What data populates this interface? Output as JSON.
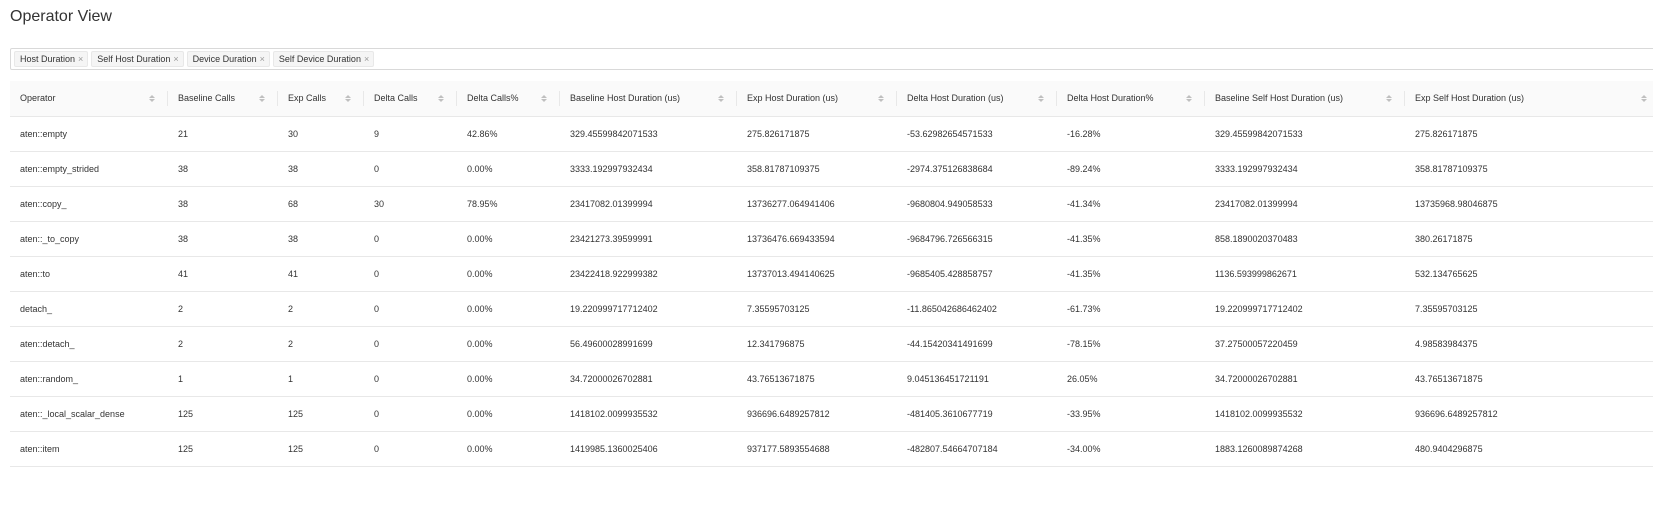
{
  "page": {
    "title": "Operator View"
  },
  "filters": {
    "tags": [
      {
        "label": "Host Duration",
        "close": "×"
      },
      {
        "label": "Self Host Duration",
        "close": "×"
      },
      {
        "label": "Device Duration",
        "close": "×"
      },
      {
        "label": "Self Device Duration",
        "close": "×"
      }
    ]
  },
  "table": {
    "columns": [
      "Operator",
      "Baseline Calls",
      "Exp Calls",
      "Delta Calls",
      "Delta Calls%",
      "Baseline Host Duration (us)",
      "Exp Host Duration (us)",
      "Delta Host Duration (us)",
      "Delta Host Duration%",
      "Baseline Self Host Duration (us)",
      "Exp Self Host Duration (us)"
    ],
    "rows": [
      [
        "aten::empty",
        "21",
        "30",
        "9",
        "42.86%",
        "329.45599842071533",
        "275.826171875",
        "-53.62982654571533",
        "-16.28%",
        "329.45599842071533",
        "275.826171875"
      ],
      [
        "aten::empty_strided",
        "38",
        "38",
        "0",
        "0.00%",
        "3333.192997932434",
        "358.81787109375",
        "-2974.375126838684",
        "-89.24%",
        "3333.192997932434",
        "358.81787109375"
      ],
      [
        "aten::copy_",
        "38",
        "68",
        "30",
        "78.95%",
        "23417082.01399994",
        "13736277.064941406",
        "-9680804.949058533",
        "-41.34%",
        "23417082.01399994",
        "13735968.98046875"
      ],
      [
        "aten::_to_copy",
        "38",
        "38",
        "0",
        "0.00%",
        "23421273.39599991",
        "13736476.669433594",
        "-9684796.726566315",
        "-41.35%",
        "858.1890020370483",
        "380.26171875"
      ],
      [
        "aten::to",
        "41",
        "41",
        "0",
        "0.00%",
        "23422418.922999382",
        "13737013.494140625",
        "-9685405.428858757",
        "-41.35%",
        "1136.593999862671",
        "532.134765625"
      ],
      [
        "detach_",
        "2",
        "2",
        "0",
        "0.00%",
        "19.220999717712402",
        "7.35595703125",
        "-11.865042686462402",
        "-61.73%",
        "19.220999717712402",
        "7.35595703125"
      ],
      [
        "aten::detach_",
        "2",
        "2",
        "0",
        "0.00%",
        "56.49600028991699",
        "12.341796875",
        "-44.15420341491699",
        "-78.15%",
        "37.27500057220459",
        "4.98583984375"
      ],
      [
        "aten::random_",
        "1",
        "1",
        "0",
        "0.00%",
        "34.72000026702881",
        "43.76513671875",
        "9.045136451721191",
        "26.05%",
        "34.72000026702881",
        "43.76513671875"
      ],
      [
        "aten::_local_scalar_dense",
        "125",
        "125",
        "0",
        "0.00%",
        "1418102.0099935532",
        "936696.6489257812",
        "-481405.3610677719",
        "-33.95%",
        "1418102.0099935532",
        "936696.6489257812"
      ],
      [
        "aten::item",
        "125",
        "125",
        "0",
        "0.00%",
        "1419985.1360025406",
        "937177.5893554688",
        "-482807.54664707184",
        "-34.00%",
        "1883.1260089874268",
        "480.9404296875"
      ]
    ]
  }
}
